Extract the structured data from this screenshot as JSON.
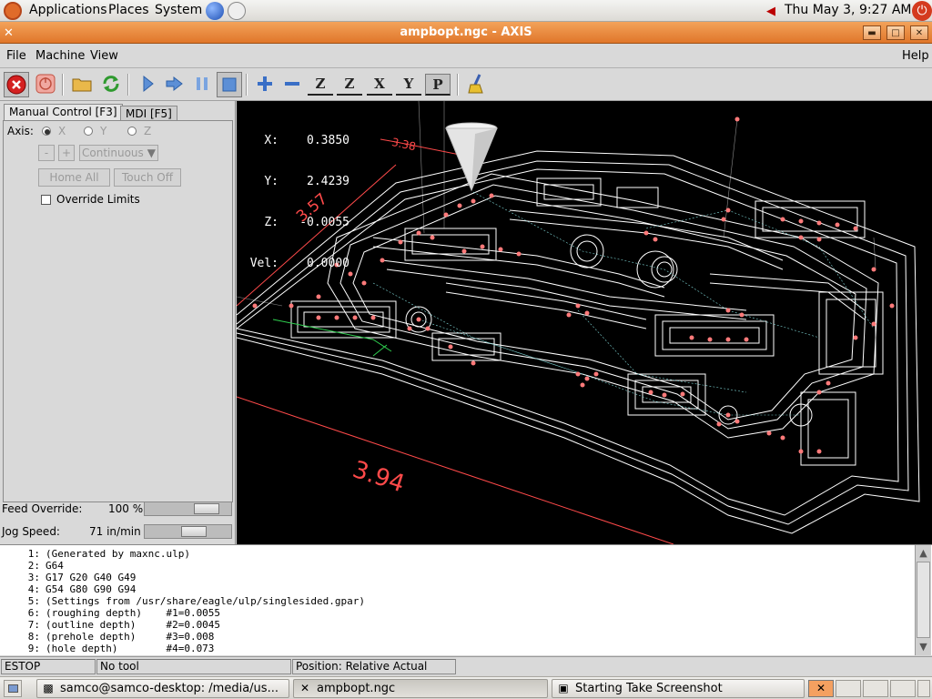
{
  "top_panel": {
    "menus": [
      "Applications",
      "Places",
      "System"
    ],
    "clock": "Thu May  3,  9:27 AM"
  },
  "window": {
    "title": "ampbopt.ngc - AXIS",
    "buttons": [
      "minimize",
      "maximize",
      "close"
    ]
  },
  "menubar": {
    "items": [
      "File",
      "Machine",
      "View"
    ],
    "help": "Help"
  },
  "toolbar": {
    "buttons": [
      "estop",
      "machine-power",
      "open-file",
      "reload-file",
      "run",
      "step",
      "pause",
      "stop",
      "zoom-in",
      "zoom-out",
      "view-z",
      "view-z-rotated",
      "view-x",
      "view-y",
      "view-p",
      "clear-plot"
    ],
    "view_letters": [
      "Z",
      "Z",
      "X",
      "Y",
      "P"
    ]
  },
  "manual_control": {
    "tabs": [
      "Manual Control [F3]",
      "MDI [F5]"
    ],
    "axis_label": "Axis:",
    "axes": [
      "X",
      "Y",
      "Z"
    ],
    "selected_axis": "X",
    "jog_minus": "-",
    "jog_plus": "+",
    "jog_mode": "Continuous",
    "home_all": "Home All",
    "touch_off": "Touch Off",
    "override_limits": "Override Limits"
  },
  "overrides": {
    "feed_label": "Feed Override:",
    "feed_value": "100 %",
    "feed_percent": 100,
    "jog_label": "Jog Speed:",
    "jog_value": "71 in/min"
  },
  "dro": {
    "x_label": "X:",
    "x": "0.3850",
    "y_label": "Y:",
    "y": "2.4239",
    "z_label": "Z:",
    "z": "-0.0055",
    "vel_label": "Vel:",
    "vel": "0.0000"
  },
  "preview": {
    "dim_width": "3.94",
    "dim_depth": "3.57",
    "dim_top": "3.38"
  },
  "gcode_lines": [
    {
      "n": "1:",
      "text": "(Generated by maxnc.ulp)"
    },
    {
      "n": "2:",
      "text": "G64"
    },
    {
      "n": "3:",
      "text": "G17 G20 G40 G49"
    },
    {
      "n": "4:",
      "text": "G54 G80 G90 G94"
    },
    {
      "n": "5:",
      "text": "(Settings from /usr/share/eagle/ulp/singlesided.gpar)"
    },
    {
      "n": "6:",
      "text": "(roughing depth)    #1=0.0055"
    },
    {
      "n": "7:",
      "text": "(outline depth)     #2=0.0045"
    },
    {
      "n": "8:",
      "text": "(prehole depth)     #3=0.008"
    },
    {
      "n": "9:",
      "text": "(hole depth)        #4=0.073"
    }
  ],
  "status": {
    "machine": "ESTOP",
    "tool": "No tool",
    "position": "Position: Relative Actual"
  },
  "taskbar": {
    "tasks": [
      "samco@samco-desktop: /media/us...",
      "ampbopt.ngc",
      "Starting Take Screenshot"
    ]
  },
  "colors": {
    "title_bar": "#e0762a",
    "preview_bg": "#000000",
    "toolpath": "#ffffff",
    "dimension": "#ff4a4a",
    "rapid": "#7fd6d6"
  }
}
